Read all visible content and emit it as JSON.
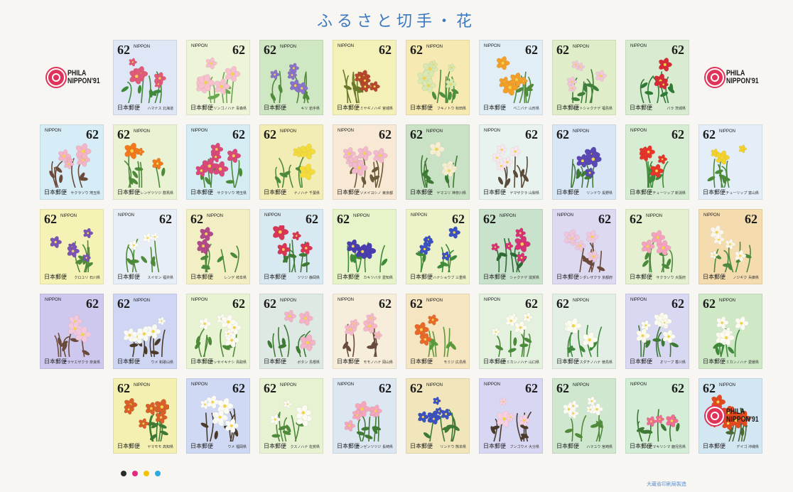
{
  "sheet": {
    "title": "ふるさと切手・花",
    "imprint": "大蔵省印刷局製造",
    "phila_label_line1": "PHILA",
    "phila_label_line2": "NIPPON'91",
    "color_dots": [
      "#2b2b2b",
      "#e2297a",
      "#f2c300",
      "#2fa9e0"
    ]
  },
  "stamp_common": {
    "denomination": "62",
    "country": "NIPPON",
    "postal": "日本郵便"
  },
  "rows": [
    [
      {
        "bg": "#dfe6f5",
        "flower": "#e05a7a",
        "leaf": "#3f8a3a",
        "type": "rose",
        "name": "ハマナス 北海道"
      },
      {
        "bg": "#eef4d8",
        "flower": "#f6c0cc",
        "leaf": "#6aa84f",
        "type": "apple",
        "name": "リンゴノハナ 青森県"
      },
      {
        "bg": "#cfe7c2",
        "flower": "#8a74c9",
        "leaf": "#4f8b3a",
        "type": "paulownia",
        "name": "キリ 岩手県"
      },
      {
        "bg": "#f3f0b8",
        "flower": "#b5482d",
        "leaf": "#6a7a2a",
        "type": "hagi",
        "name": "ミヤギノハギ 宮城県"
      },
      {
        "bg": "#f6eab2",
        "flower": "#d9e8b0",
        "leaf": "#4e8f3c",
        "type": "fuki",
        "name": "フキノトウ 秋田県"
      },
      {
        "bg": "#e1eef5",
        "flower": "#f2a02a",
        "leaf": "#4f8b3a",
        "type": "safflower",
        "name": "ベニバナ 山形県"
      },
      {
        "bg": "#dfeec9",
        "flower": "#f2c8d8",
        "leaf": "#3f7f3a",
        "type": "rhodo",
        "name": "ネモトシャクナゲ 福島県"
      },
      {
        "bg": "#d9ecd1",
        "flower": "#d62a36",
        "leaf": "#2f7a35",
        "type": "rose2",
        "name": "バラ 茨城県"
      }
    ],
    [
      {
        "bg": "#d6ecf6",
        "flower": "#f4b4c6",
        "leaf": "#6b4a3a",
        "type": "sakura",
        "name": "サクラソウ 埼玉県"
      },
      {
        "bg": "#e9f2d2",
        "flower": "#f07a1c",
        "leaf": "#4d8a3a",
        "type": "azalea",
        "name": "レンゲツツジ 群馬県"
      },
      {
        "bg": "#d6ecf3",
        "flower": "#d94a7a",
        "leaf": "#4a8a3a",
        "type": "primula",
        "name": "サクラソウ 埼玉県"
      },
      {
        "bg": "#f2ecb5",
        "flower": "#f3dc3a",
        "leaf": "#4a8a3a",
        "type": "rape",
        "name": "ナノハナ 千葉県"
      },
      {
        "bg": "#f7e9d3",
        "flower": "#f2b8cc",
        "leaf": "#6a5a3a",
        "type": "yoshino",
        "name": "ソメイヨシノ 東京都"
      },
      {
        "bg": "#c9e1c4",
        "flower": "#f6eed0",
        "leaf": "#3f7a35",
        "type": "lily",
        "name": "ヤマユリ 神奈川県"
      },
      {
        "bg": "#e8f3ef",
        "flower": "#f8e8ee",
        "leaf": "#5a4a3a",
        "type": "yamazakura",
        "name": "ヤマザクラ 山梨県"
      },
      {
        "bg": "#d8e6f6",
        "flower": "#5a49b5",
        "leaf": "#3f7a35",
        "type": "gentian",
        "name": "リンドウ 長野県"
      },
      {
        "bg": "#d7edd3",
        "flower": "#e8352c",
        "leaf": "#3f8a3a",
        "type": "tulip",
        "name": "チューリップ 新潟県"
      },
      {
        "bg": "#e3eef8",
        "flower": "#f3d22a",
        "leaf": "#4a8a3a",
        "type": "tulip2",
        "name": "チューリップ 富山県"
      }
    ],
    [
      {
        "bg": "#f5f2b6",
        "flower": "#7a55b5",
        "leaf": "#4f8a3a",
        "type": "bell",
        "name": "クロユリ 石川県"
      },
      {
        "bg": "#e8eef6",
        "flower": "#fbfbf4",
        "leaf": "#4f8a3a",
        "type": "narcissus",
        "name": "スイセン 福井県"
      },
      {
        "bg": "#f3efc4",
        "flower": "#b24a8a",
        "leaf": "#4a8a3a",
        "type": "vetch",
        "name": "レンゲ 岐阜県"
      },
      {
        "bg": "#d9e9f1",
        "flower": "#d93656",
        "leaf": "#3f7a35",
        "type": "azalea2",
        "name": "ツツジ 静岡県"
      },
      {
        "bg": "#e7f3c8",
        "flower": "#4a3db0",
        "leaf": "#3f8a3a",
        "type": "iris",
        "name": "カキツバタ 愛知県"
      },
      {
        "bg": "#eef2c9",
        "flower": "#3b52c0",
        "leaf": "#3f8a3a",
        "type": "iris2",
        "name": "ハナショウブ 三重県"
      },
      {
        "bg": "#c9e2cc",
        "flower": "#d83276",
        "leaf": "#2f6a35",
        "type": "rhodo2",
        "name": "シャクナゲ 滋賀県"
      },
      {
        "bg": "#dcd9f1",
        "flower": "#f0c6dc",
        "leaf": "#6a4a3a",
        "type": "shidare",
        "name": "シダレザクラ 京都府"
      },
      {
        "bg": "#e4f0cf",
        "flower": "#f3a3be",
        "leaf": "#4a8a3a",
        "type": "primrose",
        "name": "サクラソウ 大阪府"
      },
      {
        "bg": "#f5dcae",
        "flower": "#fbf6ea",
        "leaf": "#4a8a3a",
        "type": "daisy",
        "name": "ノジギク 兵庫県"
      }
    ],
    [
      {
        "bg": "#cfc8ee",
        "flower": "#f3c8dc",
        "leaf": "#6a4a3a",
        "type": "naraya",
        "name": "ナラヤエザクラ 奈良県"
      },
      {
        "bg": "#cfd6f4",
        "flower": "#fafaf5",
        "leaf": "#4a3a2a",
        "type": "ume",
        "name": "ウメ 和歌山県"
      },
      {
        "bg": "#e7f3d3",
        "flower": "#fbfbf2",
        "leaf": "#4f8a3a",
        "type": "nashi",
        "name": "ニジッセイキナシ 鳥取県"
      },
      {
        "bg": "#dfe9e4",
        "flower": "#f3b3c6",
        "leaf": "#3f7a35",
        "type": "peony",
        "name": "ボタン 島根県"
      },
      {
        "bg": "#f6eedb",
        "flower": "#f5b8c8",
        "leaf": "#6a4a3a",
        "type": "momo",
        "name": "モモノハナ 岡山県"
      },
      {
        "bg": "#f6e5c1",
        "flower": "#e86a2a",
        "leaf": "#5a9a3a",
        "type": "momiji",
        "name": "モミジ 広島県"
      },
      {
        "bg": "#e4f1df",
        "flower": "#fbfbee",
        "leaf": "#4a8a3a",
        "type": "natsu",
        "name": "ナツミカンノハナ 山口県"
      },
      {
        "bg": "#e3efe4",
        "flower": "#fbfbee",
        "leaf": "#3f8a3a",
        "type": "sudachi",
        "name": "スダチノハナ 徳島県"
      },
      {
        "bg": "#d8d8f2",
        "flower": "#fbfbee",
        "leaf": "#3f7a35",
        "type": "olive",
        "name": "オリーブ 香川県"
      },
      {
        "bg": "#cfe9c7",
        "flower": "#fbfbf2",
        "leaf": "#3f8a3a",
        "type": "mikan",
        "name": "ミカンノハナ 愛媛県"
      }
    ],
    [
      {
        "bg": "#f3f0b2",
        "flower": "#d8602a",
        "leaf": "#3f7a35",
        "type": "yamamomo",
        "name": "ヤマモモ 高知県"
      },
      {
        "bg": "#cfd9f3",
        "flower": "#fbfbf6",
        "leaf": "#4a3a2a",
        "type": "ume2",
        "name": "ウメ 福岡県"
      },
      {
        "bg": "#e7f2d3",
        "flower": "#fbfbf4",
        "leaf": "#4f8a3a",
        "type": "kusu",
        "name": "クスノハナ 佐賀県"
      },
      {
        "bg": "#dce7f2",
        "flower": "#f4a6bc",
        "leaf": "#3f7a35",
        "type": "unzen",
        "name": "ウンゼンツツジ 長崎県"
      },
      {
        "bg": "#f1e5bb",
        "flower": "#3c53bf",
        "leaf": "#3f7a35",
        "type": "gentian2",
        "name": "リンドウ 熊本県"
      },
      {
        "bg": "#d8d7f3",
        "flower": "#f6cfe0",
        "leaf": "#4a3a2a",
        "type": "bungo",
        "name": "ブンゴウメ 大分県"
      },
      {
        "bg": "#cfe7cf",
        "flower": "#fbfbf4",
        "leaf": "#4f8a3a",
        "type": "hamayu",
        "name": "ハマユウ 宮崎県"
      },
      {
        "bg": "#d4edd6",
        "flower": "#ef6e92",
        "leaf": "#3f7a35",
        "type": "miyama",
        "name": "ミヤマキリシマ 鹿児島県"
      },
      {
        "bg": "#d3e7f3",
        "flower": "#e2491e",
        "leaf": "#4a6a35",
        "type": "deigo",
        "name": "デイゴ 沖縄県"
      }
    ]
  ]
}
